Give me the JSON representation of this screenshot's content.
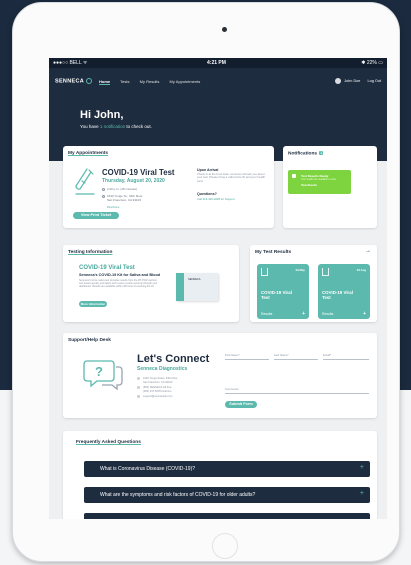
{
  "status_bar": {
    "carrier": "●●●○○ BELL ᯤ",
    "time": "4:21 PM",
    "battery": "✱ 22% ▭"
  },
  "nav": {
    "logo": "SENNECA",
    "links": [
      "Home",
      "Tests",
      "My Results",
      "My Appointments"
    ],
    "active_link": "Home",
    "user_name": "John Doe",
    "logout": "Log Out"
  },
  "hero": {
    "greeting": "Hi John,",
    "sub_prefix": "You have ",
    "sub_highlight": "1 notification",
    "sub_suffix": " to check out."
  },
  "appointments": {
    "title": "My Appointments",
    "test_name": "COVID-19 Viral Test",
    "date": "Thursday, August 20, 2020",
    "time": "2:30 p.m. (15 minutes)",
    "address_line1": "1640 Yonge St., 34th Floor",
    "address_line2": "San Francisco, CA 94103",
    "directions": "Directions",
    "arrival_heading": "Upon Arrival",
    "arrival_text": "Check in at the front desk, someone will ask you about your test. Please bring a valid photo ID and your health card.",
    "questions_heading": "Questions?",
    "questions_link": "Call 416-420-2828 for Support",
    "button": "View Print Ticket"
  },
  "notifications": {
    "title": "Notifications",
    "count": "1",
    "item_title": "Test Results Ready",
    "item_sub": "Your results are available to view",
    "item_link": "View Results"
  },
  "testing_info": {
    "title": "Testing Information",
    "heading": "COVID-19 Viral Test",
    "subheading": "Senneca's COVID-19 Kit for Saliva and Blood",
    "body": "Senneca's home saliva test provides results from the RT-PCR method. Get tested quickly and safely and receive results securely through your dashboard. Results are available within 48 hours of returning the kit.",
    "button": "More Information",
    "kit_label": "SENNECA"
  },
  "test_results": {
    "title": "My Test Results",
    "arrow": "→",
    "cards": [
      {
        "date": "03 May",
        "title": "COVID-19 Viral Test",
        "footer": "Results"
      },
      {
        "date": "03 Aug",
        "title": "COVID-19 Viral Test",
        "footer": "Results"
      }
    ],
    "plus": "+"
  },
  "support": {
    "title": "Support/Help Desk",
    "heading": "Let's Connect",
    "subheading": "Senneca Diagnostics",
    "address1": "1640 Yonge Street, 34th Floor",
    "address2": "San Francisco, CA 94103",
    "phone1": "(800) SENNECA toll free",
    "phone2": "(480) 437-5478 local line",
    "email": "support@sennecadx.com",
    "fields": {
      "first_name": "First Name*",
      "last_name": "Last Name*",
      "email": "Email*",
      "comments": "Comments"
    },
    "button": "Submit Form"
  },
  "faq": {
    "title": "Frequently Asked Questions",
    "items": [
      "What is Coronavirus Disease (COVID-19)?",
      "What are the symptoms and risk factors of COVID-19 for older adults?",
      ""
    ],
    "plus": "+"
  }
}
